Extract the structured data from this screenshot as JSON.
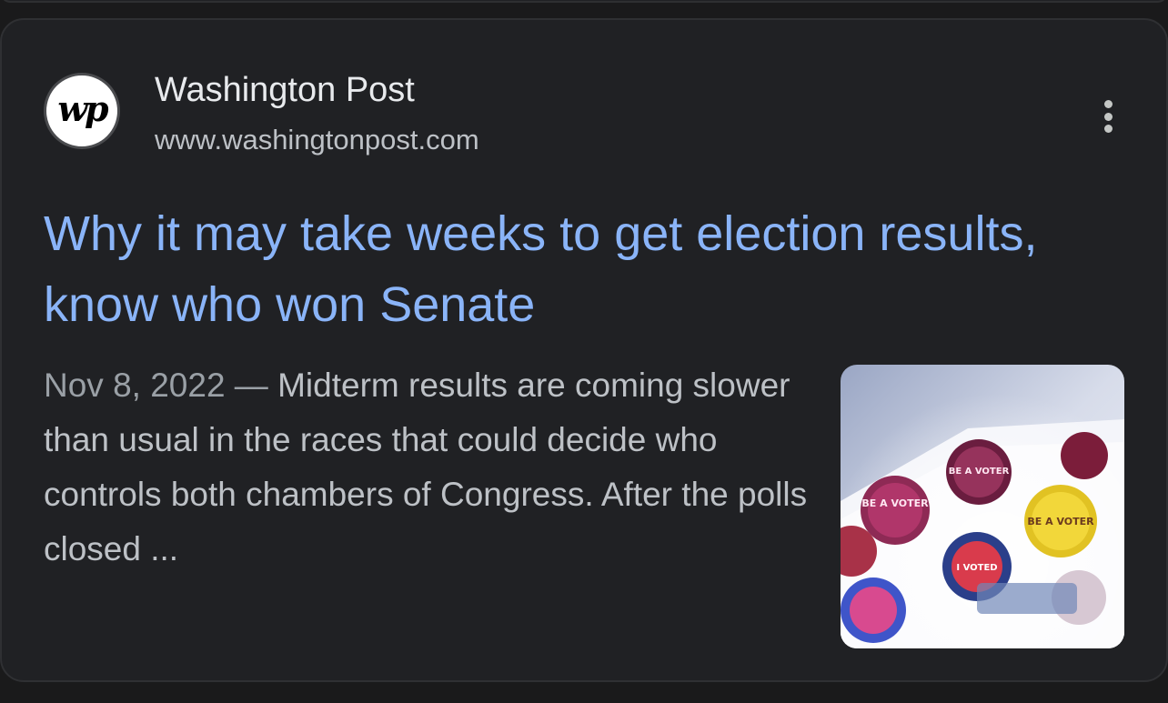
{
  "result": {
    "site_name": "Washington Post",
    "site_url": "www.washingtonpost.com",
    "favicon_text": "wp",
    "title": "Why it may take weeks to get election results, know who won Senate",
    "date": "Nov 8, 2022",
    "date_separator": " — ",
    "snippet": "Midterm results are coming slower than usual in the races that could decide who controls both chambers of Congress. After the polls closed ...",
    "thumbnail": {
      "description_icon": "voter-stickers-image",
      "sticker_texts": [
        "BE A VOTER",
        "BE A VOTER",
        "I VOTED",
        "BE A VOTER"
      ]
    },
    "more_icon": "more-vert-icon"
  },
  "colors": {
    "background": "#202124",
    "title_link": "#8ab4f8",
    "primary_text": "#e8eaed",
    "secondary_text": "#bdc1c6"
  }
}
